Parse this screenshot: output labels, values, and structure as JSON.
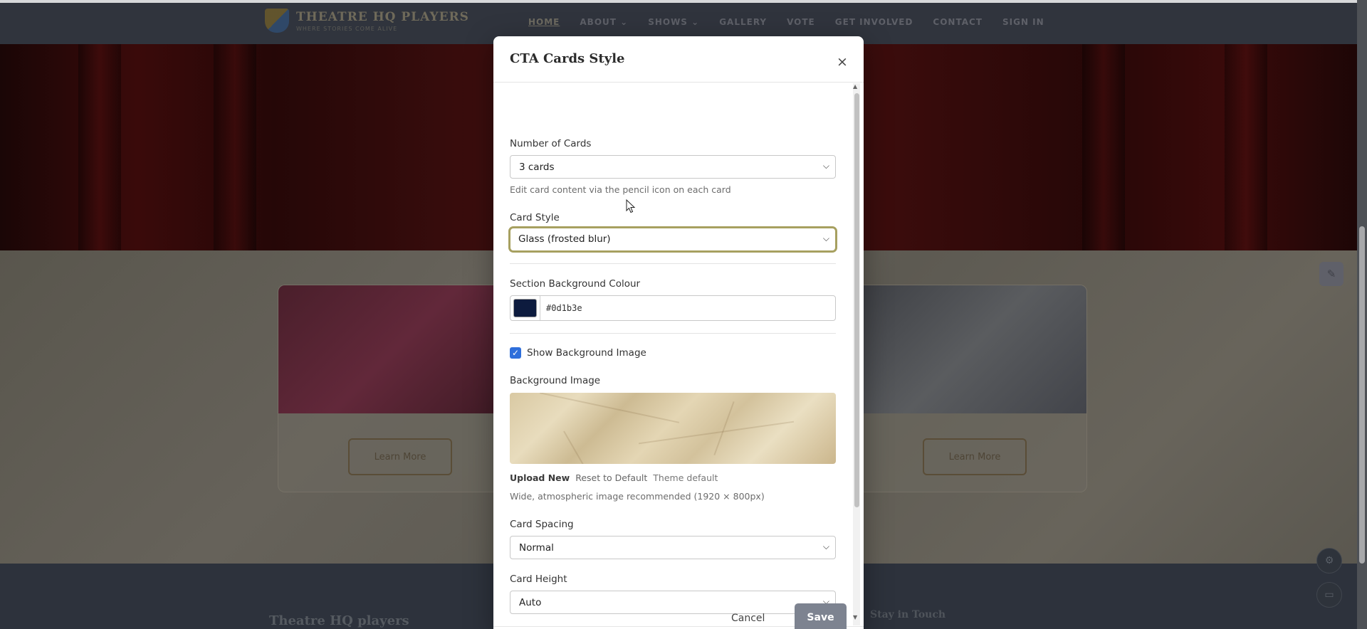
{
  "site": {
    "brand_name": "THEATRE HQ PLAYERS",
    "brand_tagline": "WHERE STORIES COME ALIVE",
    "nav": [
      "HOME",
      "ABOUT ⌄",
      "SHOWS ⌄",
      "GALLERY",
      "VOTE",
      "GET INVOLVED",
      "CONTACT",
      "SIGN IN"
    ],
    "cta_button_label": "Learn More",
    "footer_brand": "Theatre HQ players",
    "footer_stay": "Stay in Touch"
  },
  "modal": {
    "title": "CTA Cards Style",
    "close_icon": "×",
    "number_of_cards": {
      "label": "Number of Cards",
      "value": "3 cards",
      "help": "Edit card content via the pencil icon on each card"
    },
    "card_style": {
      "label": "Card Style",
      "value": "Glass (frosted blur)"
    },
    "section_bg_colour": {
      "label": "Section Background Colour",
      "value": "#0d1b3e"
    },
    "show_bg_image": {
      "label": "Show Background Image",
      "checked": true
    },
    "background_image": {
      "label": "Background Image",
      "upload": "Upload New",
      "reset": "Reset to Default",
      "theme_default": "Theme default",
      "help": "Wide, atmospheric image recommended (1920 × 800px)"
    },
    "card_spacing": {
      "label": "Card Spacing",
      "value": "Normal"
    },
    "card_height": {
      "label": "Card Height",
      "value": "Auto"
    },
    "cancel": "Cancel",
    "save": "Save"
  },
  "colors": {
    "accent_focus": "#a7a060",
    "checkbox": "#2f6fdb",
    "save_button": "#7d8390",
    "swatch": "#0d1b3e"
  }
}
